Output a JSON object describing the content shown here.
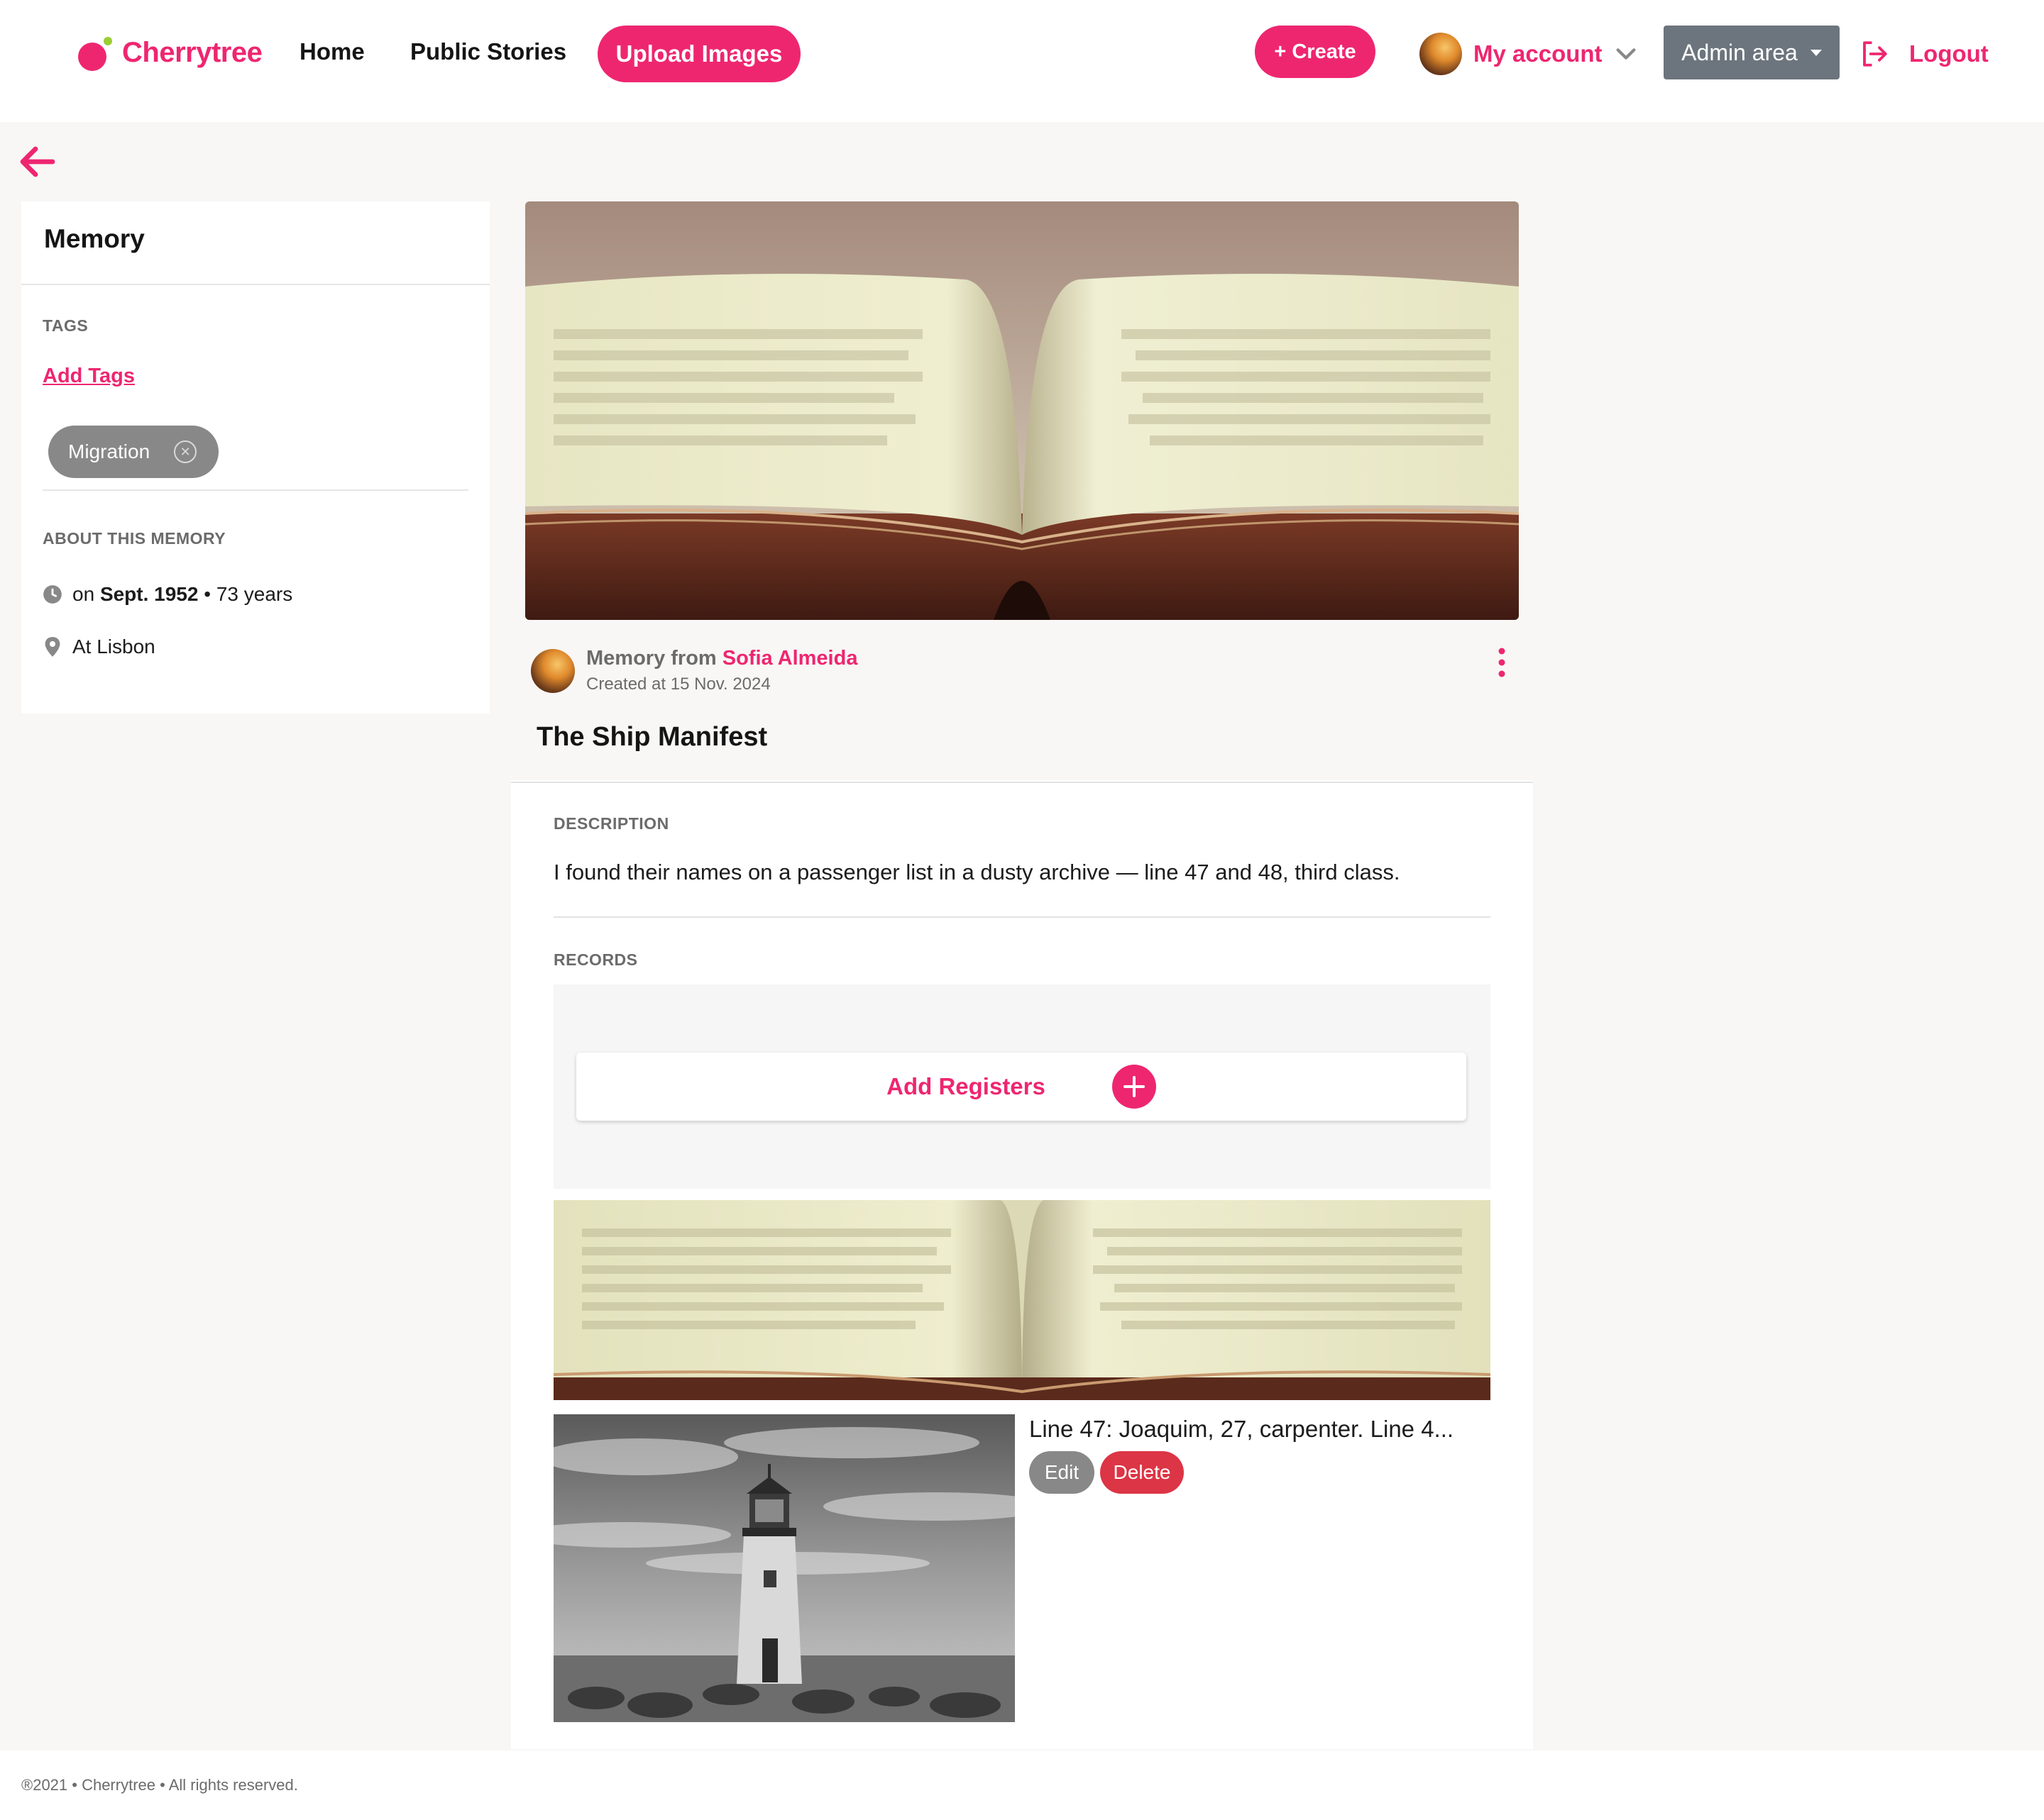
{
  "brand": {
    "name": "Cherrytree",
    "accent": "#ee2670",
    "leaf": "#9acd32"
  },
  "header": {
    "nav": {
      "home": "Home",
      "public_stories": "Public Stories"
    },
    "upload_label": "Upload Images",
    "create_label": "+ Create",
    "account_label": "My account",
    "admin_label": "Admin area",
    "logout_label": "Logout"
  },
  "sidebar": {
    "title": "Memory",
    "tags_heading": "TAGS",
    "add_tags_label": "Add Tags",
    "tags": [
      "Migration"
    ],
    "about_heading": "ABOUT THIS MEMORY",
    "date_prefix": "on",
    "date_value": "Sept. 1952",
    "date_separator": "•",
    "date_age": "73 years",
    "location": "At Lisbon"
  },
  "memory": {
    "from_prefix": "Memory from",
    "author": "Sofia Almeida",
    "created": "Created at 15 Nov. 2024",
    "title": "The Ship Manifest",
    "description_heading": "DESCRIPTION",
    "description": "I found their names on a passenger list in a dusty archive — line 47 and 48, third class.",
    "records_heading": "RECORDS",
    "add_registers_label": "Add Registers",
    "record": {
      "text": "Line 47: Joaquim, 27, carpenter. Line 4...",
      "edit_label": "Edit",
      "delete_label": "Delete"
    }
  },
  "footer": {
    "text": "®2021 • Cherrytree • All rights reserved."
  },
  "icons": [
    "back-arrow-icon",
    "clock-icon",
    "location-pin-icon",
    "kebab-menu-icon",
    "plus-icon",
    "logout-icon",
    "chevron-down-icon",
    "close-circle-icon"
  ]
}
